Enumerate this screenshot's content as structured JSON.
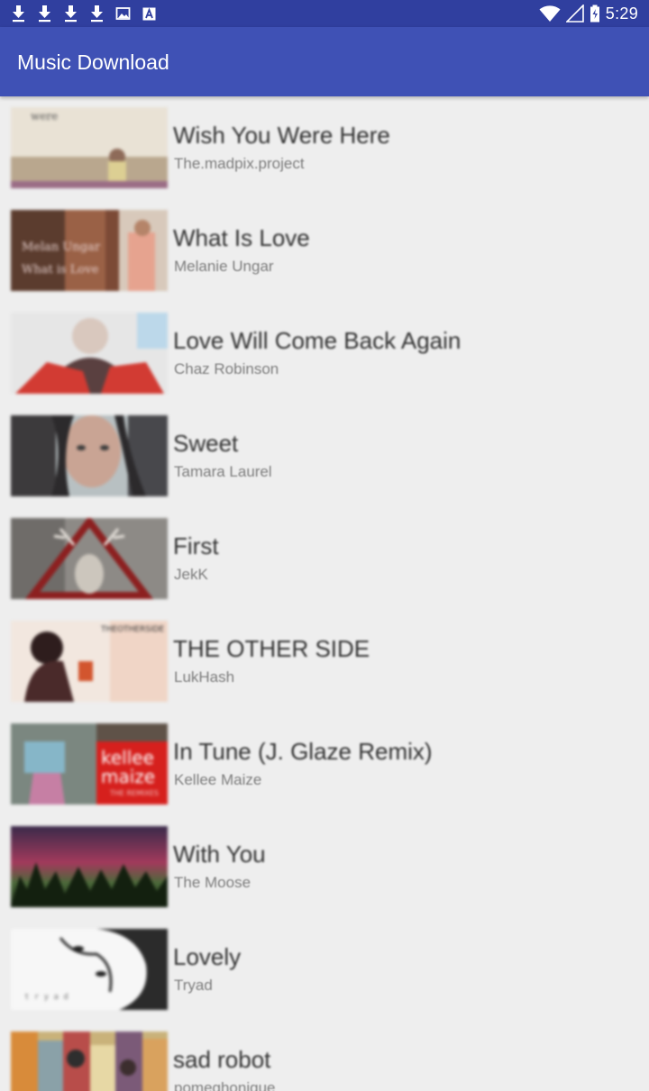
{
  "status_bar": {
    "time": "5:29",
    "left_icons": [
      "download-icon",
      "download-icon",
      "download-icon",
      "download-icon",
      "image-icon",
      "font-icon"
    ],
    "right_icons": [
      "wifi-icon",
      "signal-icon",
      "battery-charging-icon"
    ]
  },
  "app_bar": {
    "title": "Music Download",
    "color": "#3f51b5",
    "status_color": "#303f9f"
  },
  "songs": [
    {
      "title": "Wish You Were Here",
      "artist": "The.madpix.project"
    },
    {
      "title": "What Is Love",
      "artist": "Melanie Ungar"
    },
    {
      "title": "Love Will Come Back Again",
      "artist": "Chaz Robinson"
    },
    {
      "title": "Sweet",
      "artist": "Tamara Laurel"
    },
    {
      "title": "First",
      "artist": "JekK"
    },
    {
      "title": "THE OTHER SIDE",
      "artist": "LukHash"
    },
    {
      "title": "In Tune (J. Glaze Remix)",
      "artist": "Kellee Maize"
    },
    {
      "title": "With You",
      "artist": "The Moose"
    },
    {
      "title": "Lovely",
      "artist": "Tryad"
    },
    {
      "title": "sad robot",
      "artist": "pomeghonique"
    }
  ]
}
